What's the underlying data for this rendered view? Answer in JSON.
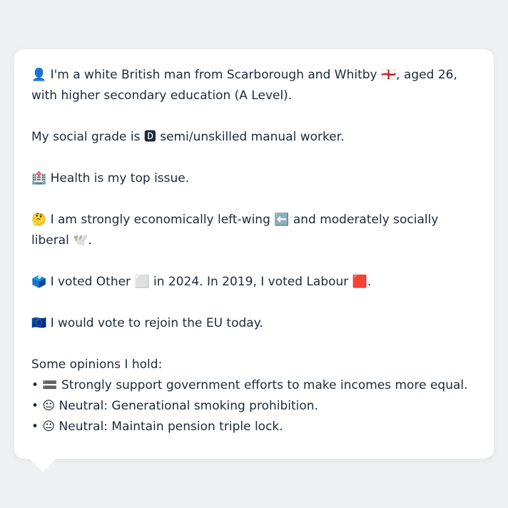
{
  "profile": {
    "intro": "👤 I'm a white British man from Scarborough and Whitby 🏴󠁧󠁢󠁥󠁮󠁧󠁿, aged 26, with higher secondary education (A Level).",
    "social_grade": "My social grade is 🅳 semi/unskilled manual worker.",
    "top_issue": "🏥 Health is my top issue.",
    "ideology": "🤔 I am strongly economically left-wing ⬅️ and moderately socially liberal 🕊️.",
    "votes": "🗳️ I voted Other ⬜ in 2024. In 2019, I voted Labour 🟥.",
    "eu": "🇪🇺 I would vote to rejoin the EU today.",
    "opinions_heading": "Some opinions I hold:",
    "opinions": [
      "• 🟰 Strongly support government efforts to make incomes more equal.",
      "• 😐 Neutral: Generational smoking prohibition.",
      "• 😐 Neutral: Maintain pension triple lock."
    ]
  },
  "colors": {
    "background": "#eff0f2",
    "bubble": "#ffffff",
    "text": "#1d2a3a"
  }
}
